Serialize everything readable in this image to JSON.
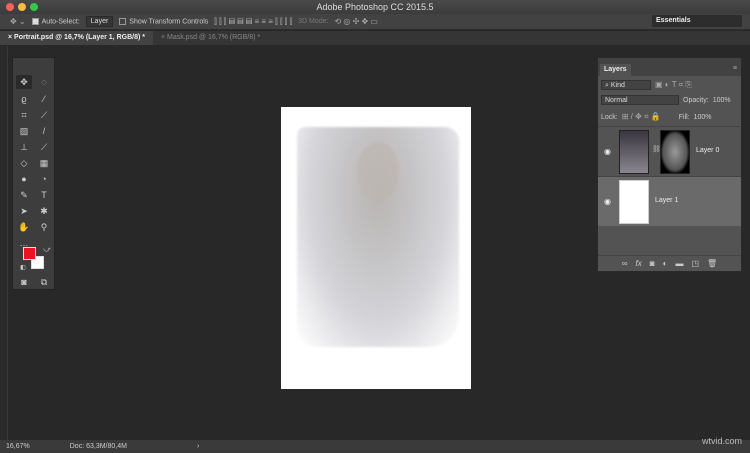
{
  "app": {
    "title": "Adobe Photoshop CC 2015.5"
  },
  "options": {
    "auto_select_label": "Auto-Select:",
    "auto_select_value": "Layer",
    "transform_label": "Show Transform Controls",
    "mode3d_label": "3D Mode:",
    "workspace": "Essentials"
  },
  "tabs": [
    {
      "label": "Portrait.psd @ 16,7% (Layer 1, RGB/8) *"
    },
    {
      "label": "Mask.psd @ 16,7% (RGB/8) *"
    }
  ],
  "layers_panel": {
    "title": "Layers",
    "filter": "Kind",
    "blend_mode": "Normal",
    "opacity_label": "Opacity:",
    "opacity": "100%",
    "lock_label": "Lock:",
    "fill_label": "Fill:",
    "fill": "100%",
    "layers": [
      {
        "name": "Layer 0"
      },
      {
        "name": "Layer 1"
      }
    ]
  },
  "colors": {
    "foreground": "#ee1122",
    "background": "#ffffff"
  },
  "status": {
    "zoom": "16,67%",
    "doc": "Doc: 63,3M/80,4M",
    "arrow": "›"
  },
  "watermark": "wtvid.com"
}
